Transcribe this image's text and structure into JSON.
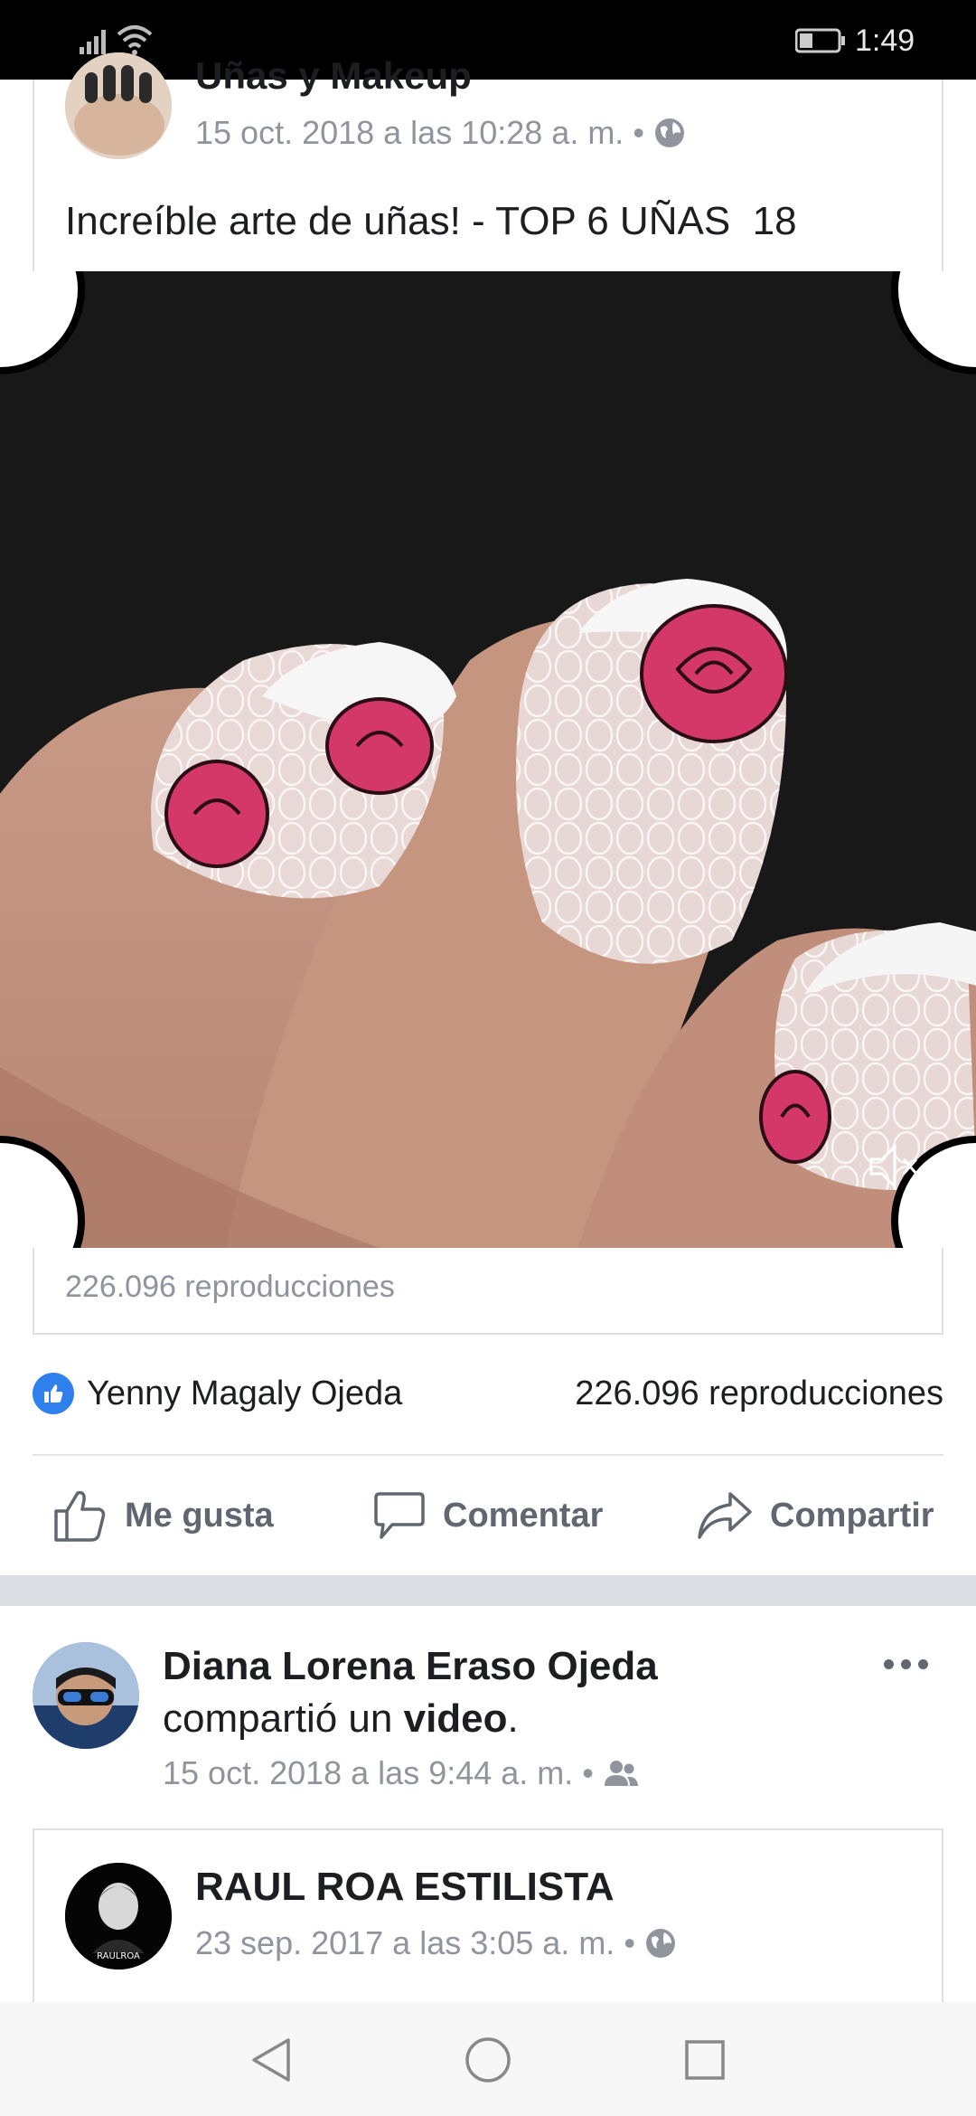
{
  "status_bar": {
    "time": "1:49"
  },
  "shared_post": {
    "page_name": "Uñas y Makeup",
    "timestamp": "15 oct. 2018 a las 10:28 a. m.",
    "audience_icon": "globe-icon",
    "caption": "Increíble arte de uñas! - TOP 6 UÑAS  18",
    "views": "226.096 reproducciones"
  },
  "reactions": {
    "reactor_name": "Yenny Magaly Ojeda",
    "views": "226.096 reproducciones"
  },
  "actions": {
    "like": "Me gusta",
    "comment": "Comentar",
    "share": "Compartir"
  },
  "second_post": {
    "author": "Diana Lorena Eraso Ojeda",
    "action_prefix": "compartió un",
    "action_object": "video",
    "action_suffix": ".",
    "timestamp": "15 oct. 2018 a las 9:44 a. m.",
    "audience_icon": "friends-icon",
    "original_page": "RAUL ROA ESTILISTA",
    "original_timestamp": "23 sep. 2017 a las 3:05 a. m.",
    "avatar_logo_text": "RAULROA"
  },
  "colors": {
    "like_blue": "#2f80ed",
    "meta_gray": "#90949c",
    "text": "#1c1e21",
    "action_gray": "#606770"
  }
}
